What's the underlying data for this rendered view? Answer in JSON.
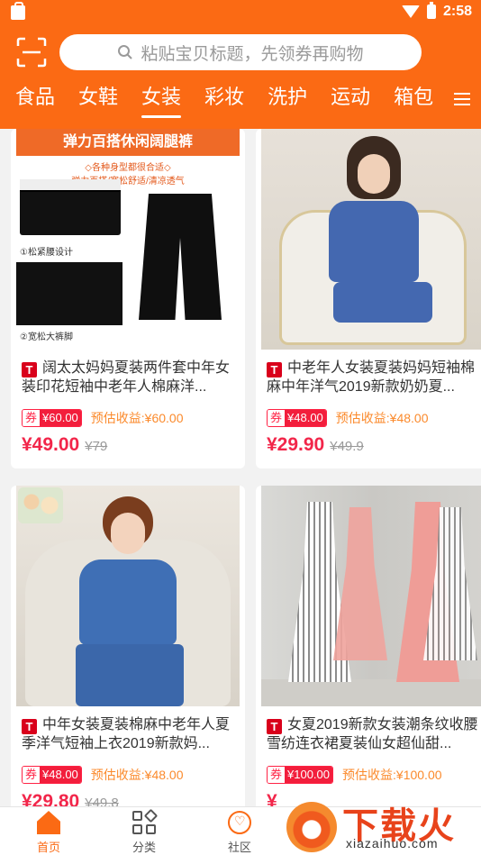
{
  "status_bar": {
    "time": "2:58"
  },
  "search": {
    "placeholder": "粘贴宝贝标题，先领券再购物"
  },
  "categories": [
    "食品",
    "女鞋",
    "女装",
    "彩妆",
    "洗护",
    "运动",
    "箱包",
    "|"
  ],
  "active_category": "女装",
  "products": [
    {
      "image_banner": "弹力百搭休闲阔腿裤",
      "image_sub": "◇各种身型都很合适◇",
      "image_sub2": "弹力百搭/宽松舒适/清凉透气",
      "image_note1": "①松紧腰设计",
      "image_note2": "②宽松大裤脚",
      "shop_badge": "T",
      "title": "阔太太妈妈夏装两件套中年女装印花短袖中老年人棉麻洋...",
      "coupon_label": "券",
      "coupon_value": "¥60.00",
      "earnings": "预估收益:¥60.00",
      "price": "¥49.00",
      "original_price": "¥79"
    },
    {
      "shop_badge": "T",
      "title": "中老年人女装夏装妈妈短袖棉麻中年洋气2019新款奶奶夏...",
      "coupon_label": "券",
      "coupon_value": "¥48.00",
      "earnings": "预估收益:¥48.00",
      "price": "¥29.90",
      "original_price": "¥49.9"
    },
    {
      "shop_badge": "T",
      "title": "中年女装夏装棉麻中老年人夏季洋气短袖上衣2019新款妈...",
      "coupon_label": "券",
      "coupon_value": "¥48.00",
      "earnings": "预估收益:¥48.00",
      "price": "¥29.80",
      "original_price": "¥49.8"
    },
    {
      "shop_badge": "T",
      "title": "女夏2019新款女装潮条纹收腰雪纺连衣裙夏装仙女超仙甜...",
      "coupon_label": "券",
      "coupon_value": "¥100.00",
      "earnings": "预估收益:¥100.00",
      "price": "¥",
      "original_price": ""
    }
  ],
  "bottom_nav": [
    {
      "label": "首页",
      "icon": "home-icon",
      "active": true
    },
    {
      "label": "分类",
      "icon": "category-icon",
      "active": false
    },
    {
      "label": "社区",
      "icon": "community-icon",
      "active": false
    }
  ],
  "watermark": {
    "text": "下载火",
    "url": "xiazaihuo.com"
  },
  "colors": {
    "accent": "#fb6a14",
    "price": "#f2264a",
    "coupon": "#f21e3c",
    "earnings": "#fb8a2c"
  }
}
